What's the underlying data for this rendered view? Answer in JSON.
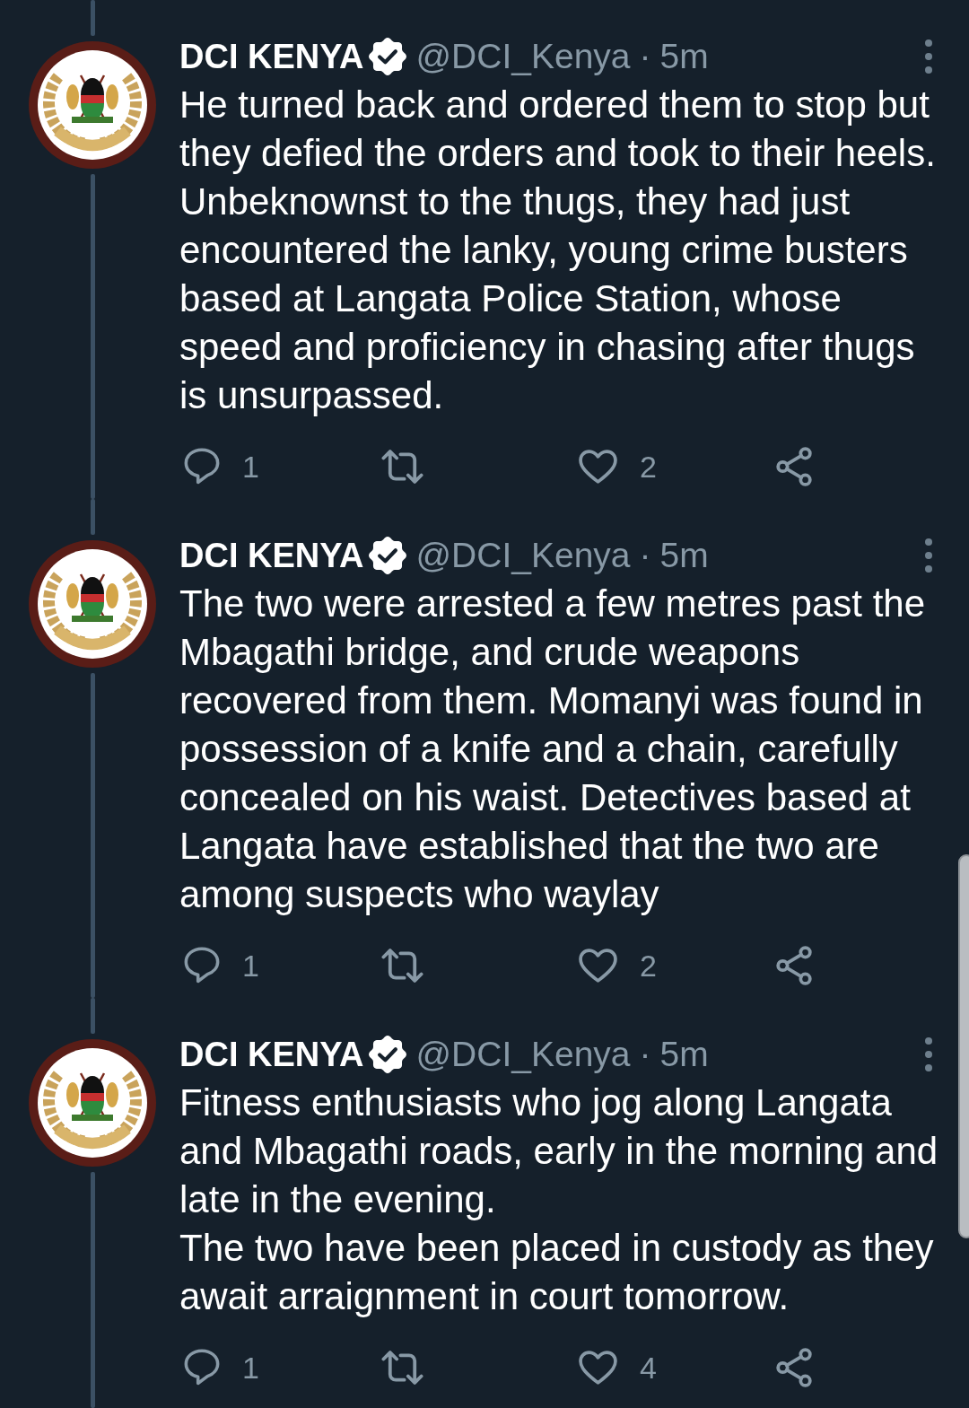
{
  "tweets": [
    {
      "author": {
        "name": "DCI KENYA",
        "verified": true,
        "handle": "@DCI_Kenya"
      },
      "separator": "·",
      "time": "5m",
      "text": "He turned back and ordered them to stop but they defied the orders and took to their heels. Unbeknownst to the thugs, they had just encountered the lanky, young crime busters based at Langata Police Station, whose speed and proficiency in chasing after thugs is unsurpassed.",
      "actions": [
        {
          "kind": "reply",
          "count": "1"
        },
        {
          "kind": "retweet"
        },
        {
          "kind": "like",
          "count": "2"
        },
        {
          "kind": "share"
        }
      ]
    },
    {
      "author": {
        "name": "DCI KENYA",
        "verified": true,
        "handle": "@DCI_Kenya"
      },
      "separator": "·",
      "time": "5m",
      "text": "The two were arrested a few metres past the Mbagathi bridge, and crude weapons recovered from them. Momanyi was found in possession of a knife and a chain, carefully concealed on his waist. Detectives based at Langata have established that the two are among suspects who waylay",
      "actions": [
        {
          "kind": "reply",
          "count": "1"
        },
        {
          "kind": "retweet"
        },
        {
          "kind": "like",
          "count": "2"
        },
        {
          "kind": "share"
        }
      ]
    },
    {
      "author": {
        "name": "DCI KENYA",
        "verified": true,
        "handle": "@DCI_Kenya"
      },
      "separator": "·",
      "time": "5m",
      "text": "Fitness enthusiasts who jog along Langata and Mbagathi roads, early in the morning and late in the evening.\nThe two have been placed in custody as they await arraignment in court tomorrow.",
      "actions": [
        {
          "kind": "reply",
          "count": "1"
        },
        {
          "kind": "retweet"
        },
        {
          "kind": "like",
          "count": "4"
        },
        {
          "kind": "share"
        }
      ]
    }
  ]
}
